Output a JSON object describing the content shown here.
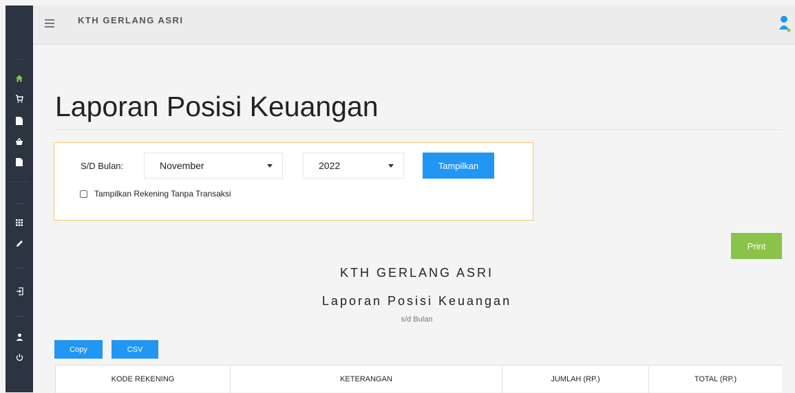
{
  "app": {
    "title": "KTH GERLANG ASRI"
  },
  "sidebar": {
    "items": [
      {
        "icon": "home-icon",
        "glyph": "🏠︎"
      },
      {
        "icon": "cart-icon",
        "glyph": "🛒︎"
      },
      {
        "icon": "document-icon",
        "glyph": "▮"
      },
      {
        "icon": "basket-icon",
        "glyph": "⛉"
      },
      {
        "icon": "document-icon",
        "glyph": "▮"
      },
      {
        "icon": "grid-icon",
        "glyph": "⠿"
      },
      {
        "icon": "pencil-icon",
        "glyph": "✎"
      },
      {
        "icon": "login-icon",
        "glyph": "⇥"
      },
      {
        "icon": "user-icon",
        "glyph": "●"
      },
      {
        "icon": "power-icon",
        "glyph": "⏻"
      }
    ],
    "separator_text": "···",
    "accent_color": "#7ec24a"
  },
  "page": {
    "title": "Laporan Posisi Keuangan"
  },
  "filter": {
    "label": "S/D Bulan:",
    "month": "November",
    "year": "2022",
    "submit_label": "Tampilkan",
    "checkbox_label": "Tampilkan Rekening Tanpa Transaksi",
    "checkbox_checked": false,
    "border_color": "#f5c96b"
  },
  "actions": {
    "print_label": "Print"
  },
  "report": {
    "org": "KTH GERLANG ASRI",
    "name": "Laporan Posisi Keuangan",
    "subtitle": "s/d Bulan"
  },
  "export": {
    "copy_label": "Copy",
    "csv_label": "CSV"
  },
  "table": {
    "columns": [
      "KODE REKENING",
      "KETERANGAN",
      "JUMLAH (RP.)",
      "TOTAL (RP.)"
    ]
  },
  "colors": {
    "primary": "#2196f3",
    "print": "#8bc34a",
    "sidebar": "#2b3440"
  }
}
